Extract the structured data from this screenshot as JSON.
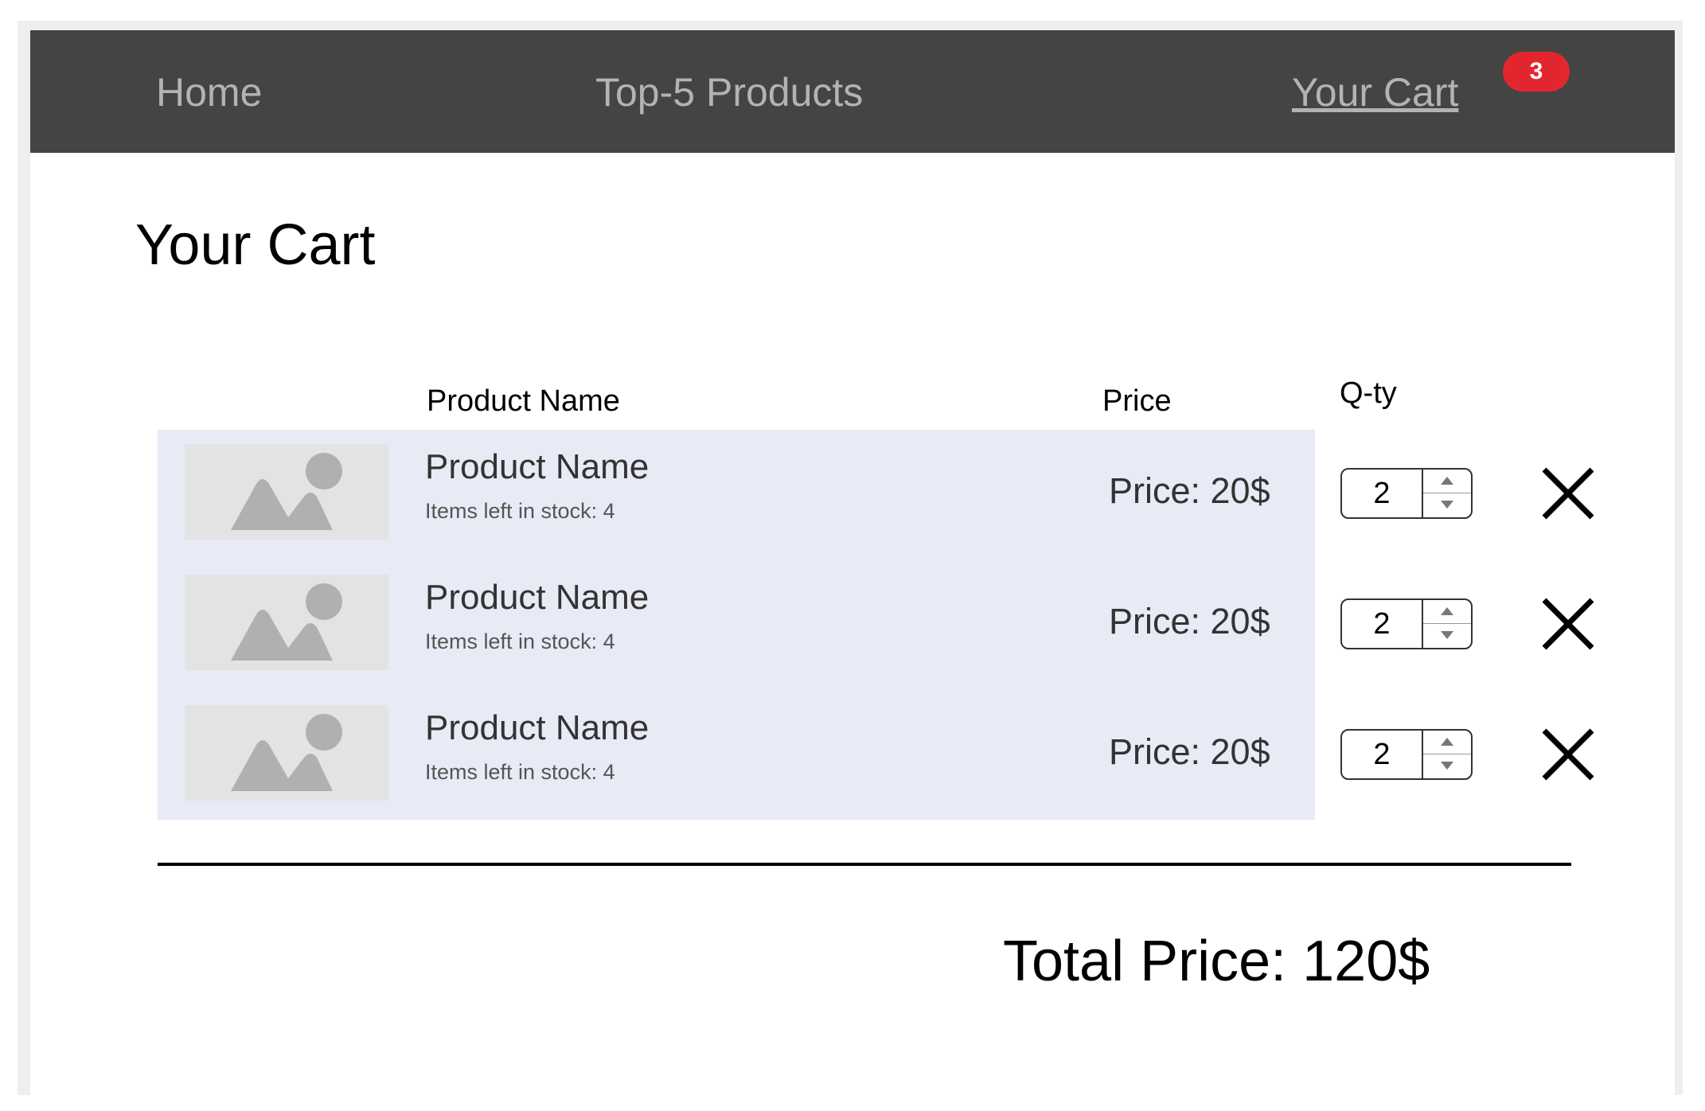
{
  "nav": {
    "home": "Home",
    "top_products": "Top-5 Products",
    "cart": "Your Cart",
    "cart_count": "3"
  },
  "page": {
    "title": "Your Cart"
  },
  "table": {
    "headers": {
      "name": "Product Name",
      "price": "Price",
      "qty": "Q-ty"
    },
    "rows": [
      {
        "name": "Product Name",
        "stock": "Items left in stock: 4",
        "price": "Price: 20$",
        "qty": "2"
      },
      {
        "name": "Product Name",
        "stock": "Items left in stock: 4",
        "price": "Price: 20$",
        "qty": "2"
      },
      {
        "name": "Product Name",
        "stock": "Items left in stock: 4",
        "price": "Price: 20$",
        "qty": "2"
      }
    ]
  },
  "total": "Total Price: 120$",
  "colors": {
    "navbar": "#444444",
    "nav_text": "#b3b3b3",
    "badge": "#e3262e",
    "row_background": "#e8eaf5",
    "thumbnail": "#e3e3e3"
  },
  "icons": {
    "thumbnail": "image-placeholder-icon",
    "remove": "close-icon",
    "increment": "caret-up-icon",
    "decrement": "caret-down-icon"
  }
}
